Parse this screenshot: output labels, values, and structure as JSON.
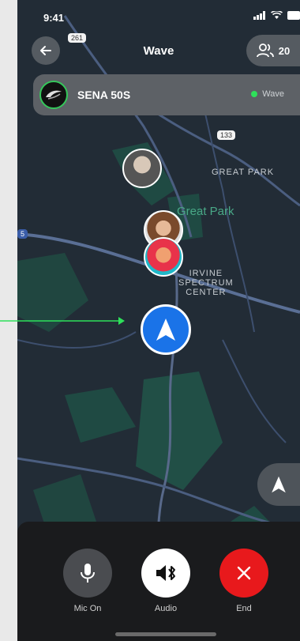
{
  "status": {
    "time": "9:41"
  },
  "header": {
    "title": "Wave",
    "members_count": "20"
  },
  "device": {
    "name": "SENA 50S",
    "status": "Wave"
  },
  "map": {
    "labels": {
      "great_park_caps": "GREAT PARK",
      "great_park": "Great Park",
      "spectrum": "IRVINE\nSPECTRUM\nCENTER"
    },
    "routes": [
      "261",
      "133",
      "5"
    ]
  },
  "controls": [
    {
      "label": "Mic On",
      "icon": "microphone-icon"
    },
    {
      "label": "Audio",
      "icon": "bluetooth-speaker-icon"
    },
    {
      "label": "End",
      "icon": "close-icon"
    }
  ],
  "colors": {
    "accent_blue": "#1a73e8",
    "end_red": "#e8191c",
    "online_green": "#2ee05a"
  }
}
